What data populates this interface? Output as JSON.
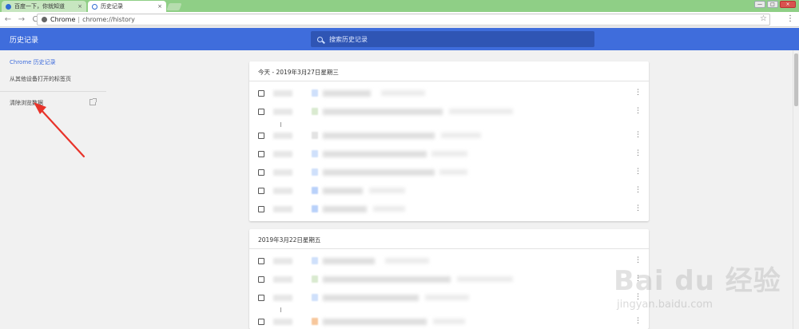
{
  "browser": {
    "tabs": [
      {
        "title": "百度一下，你就知道",
        "icon": "baidu-paw-icon"
      },
      {
        "title": "历史记录",
        "icon": "history-clock-icon"
      }
    ],
    "close_glyph": "×",
    "window_controls": [
      "—",
      "□",
      "×"
    ],
    "url": {
      "scheme": "Chrome",
      "separator": "|",
      "path": "chrome://history"
    },
    "nav": {
      "back": "←",
      "forward": "→",
      "reload": "C"
    },
    "star": "☆",
    "menu": "⋮"
  },
  "header": {
    "title": "历史记录",
    "search_placeholder": "搜索历史记录"
  },
  "sidebar": {
    "items": [
      {
        "label": "Chrome 历史记录",
        "active": true
      },
      {
        "label": "从其他设备打开的标签页",
        "active": false
      },
      {
        "label": "清除浏览数据",
        "active": false
      }
    ]
  },
  "history": {
    "groups": [
      {
        "title": "今天 - 2019年3月27日星期三",
        "row_count": 7
      },
      {
        "title": "2019年3月22日星期五",
        "row_count": 4
      }
    ]
  },
  "row_menu_glyph": "⋮",
  "watermark": {
    "logo": "Bai du 经验",
    "url": "jingyan.baidu.com"
  },
  "colors": {
    "header_blue": "#3f6ddc",
    "tab_strip_green": "#8fcf86",
    "annotation_red": "#e8332a"
  }
}
